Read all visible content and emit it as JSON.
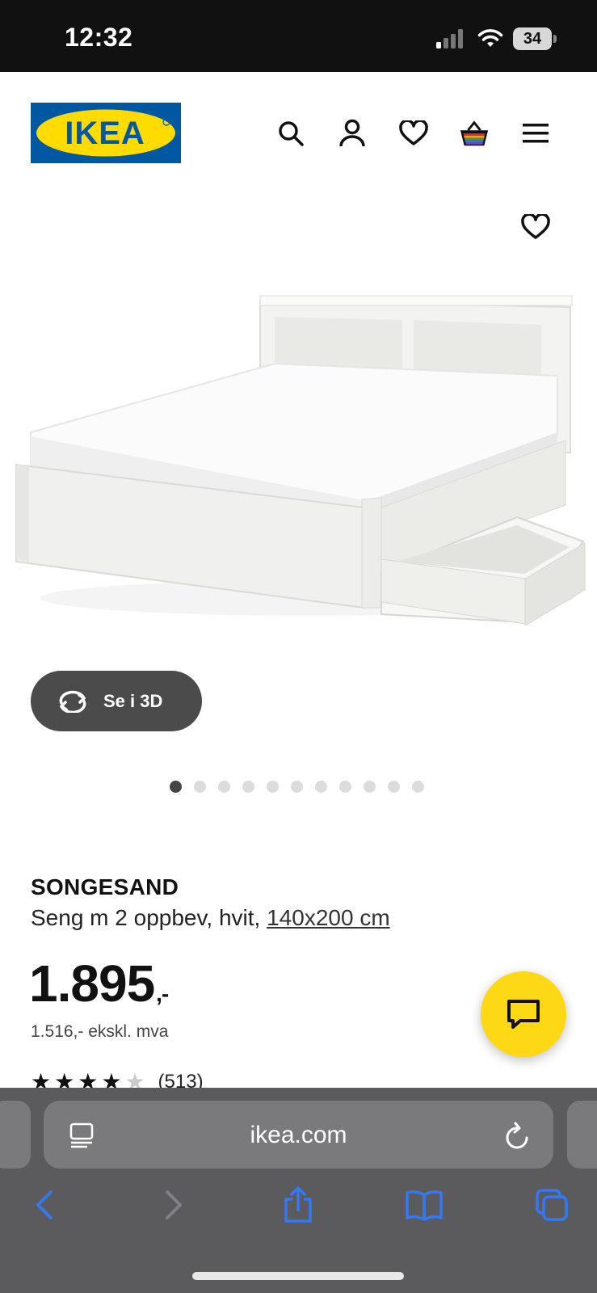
{
  "status_bar": {
    "time": "12:32",
    "battery": "34"
  },
  "header": {
    "logo_text": "IKEA",
    "icons": [
      "search-icon",
      "account-icon",
      "heart-icon",
      "basket-icon",
      "menu-icon"
    ]
  },
  "gallery": {
    "view_3d_label": "Se i 3D",
    "dot_count": 11,
    "active_dot": 1
  },
  "product": {
    "name": "SONGESAND",
    "desc_prefix": "Seng m 2 oppbev, hvit, ",
    "size": "140x200 cm",
    "price": "1.895",
    "price_suffix": ",-",
    "price_excl": "1.516,- ekskl. mva",
    "rating_stars": 4.5,
    "rating_count": "(513)"
  },
  "browser": {
    "url": "ikea.com"
  },
  "colors": {
    "ikea_blue": "#0058a3",
    "ikea_yellow": "#ffdb00",
    "chat_yellow": "#fcd815",
    "safari_blue": "#3478f6"
  }
}
